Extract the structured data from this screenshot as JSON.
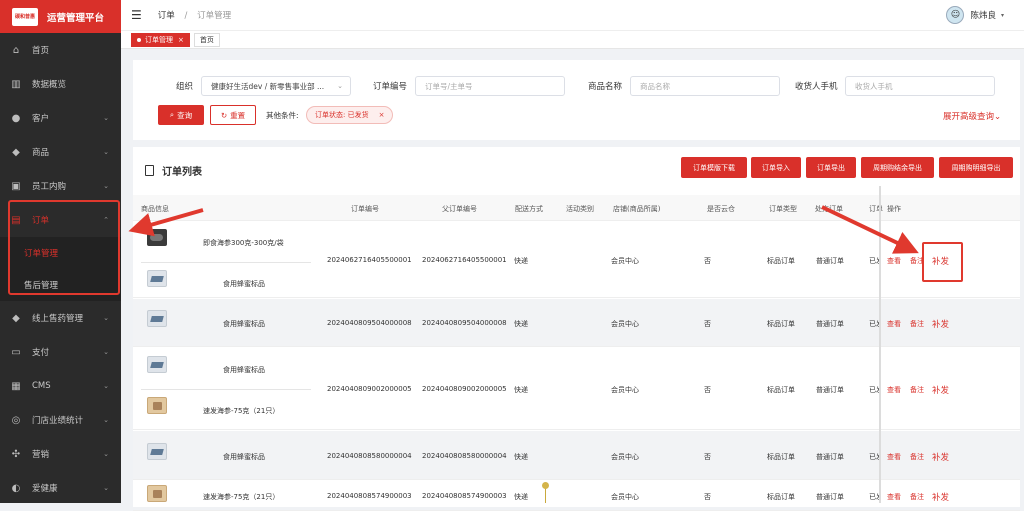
{
  "app": {
    "title": "运营管理平台",
    "logo_text": "碳和普惠"
  },
  "sidebar": {
    "items": [
      {
        "label": "首页",
        "icon": "home-icon",
        "glyph": "⌂"
      },
      {
        "label": "数据概览",
        "icon": "dashboard-icon",
        "glyph": "▥"
      },
      {
        "label": "客户",
        "icon": "user-icon",
        "glyph": "●",
        "chevron": "⌄"
      },
      {
        "label": "商品",
        "icon": "diamond-icon",
        "glyph": "◆",
        "chevron": "⌄"
      },
      {
        "label": "员工内购",
        "icon": "bag-icon",
        "glyph": "▣",
        "chevron": "⌄"
      },
      {
        "label": "订单",
        "icon": "order-icon",
        "glyph": "▤",
        "chevron": "⌃"
      },
      {
        "label": "线上售药管理",
        "icon": "diamond-icon",
        "glyph": "◆",
        "chevron": "⌄"
      },
      {
        "label": "支付",
        "icon": "wallet-icon",
        "glyph": "▭",
        "chevron": "⌄"
      },
      {
        "label": "CMS",
        "icon": "grid-icon",
        "glyph": "▦",
        "chevron": "⌄"
      },
      {
        "label": "门店业绩统计",
        "icon": "person-icon",
        "glyph": "◎",
        "chevron": "⌄"
      },
      {
        "label": "营销",
        "icon": "network-icon",
        "glyph": "✣",
        "chevron": "⌄"
      },
      {
        "label": "爱健康",
        "icon": "heart-icon",
        "glyph": "◐",
        "chevron": "⌄"
      }
    ],
    "sub_items": [
      {
        "label": "订单管理"
      },
      {
        "label": "售后管理"
      }
    ]
  },
  "topbar": {
    "menu_glyph": "☰",
    "breadcrumb": [
      "订单",
      "订单管理"
    ],
    "breadcrumb_sep": "/",
    "user_name": "陈炜良",
    "user_glyph": "☺",
    "dropdown_glyph": "▾"
  },
  "tabs": [
    {
      "label": "订单管理",
      "close": "×",
      "active": true
    },
    {
      "label": "首页",
      "active": false
    }
  ],
  "filters": {
    "org_label": "组织",
    "org_value": "健康好生活dev / 新零售事业部 ...",
    "order_no_label": "订单编号",
    "order_no_placeholder": "订单号/主单号",
    "product_label": "商品名称",
    "product_placeholder": "商品名称",
    "phone_label": "收货人手机",
    "phone_placeholder": "收货人手机",
    "query_button": "查询",
    "query_glyph": "⌕",
    "reset_button": "重置",
    "reset_glyph": "↻",
    "other_label": "其他条件:",
    "chip_label": "订单状态: 已发货",
    "chip_close": "×",
    "advanced_label": "展开高级查询",
    "chevron": "⌄"
  },
  "list": {
    "title": "订单列表",
    "actions": [
      "订单模版下载",
      "订单导入",
      "订单导出",
      "周期购结余导出",
      "周期购明细导出"
    ],
    "columns": [
      "商品信息",
      "订单编号",
      "父订单编号",
      "配送方式",
      "活动类别",
      "店铺(商品所属)",
      "是否云仓",
      "订单类型",
      "处方订单",
      "订单",
      "操作"
    ],
    "rows": [
      {
        "products": [
          {
            "name": "即食海参300克-300克/袋",
            "image": "sea-cucumber"
          },
          {
            "name": "食用蜂蜜标品",
            "image": "honey-box"
          }
        ],
        "order_no": "2024062716405500001",
        "parent_no": "2024062716405500001",
        "delivery": "快递",
        "activity": "",
        "shop": "会员中心",
        "cloud": "否",
        "type": "标品订单",
        "rx": "普通订单",
        "status": "已发",
        "ops": [
          "查看",
          "备注",
          "补发"
        ]
      },
      {
        "products": [
          {
            "name": "食用蜂蜜标品",
            "image": "honey-box"
          }
        ],
        "order_no": "2024040809504000008",
        "parent_no": "2024040809504000008",
        "delivery": "快递",
        "activity": "",
        "shop": "会员中心",
        "cloud": "否",
        "type": "标品订单",
        "rx": "普通订单",
        "status": "已发",
        "ops": [
          "查看",
          "备注",
          "补发"
        ]
      },
      {
        "products": [
          {
            "name": "食用蜂蜜标品",
            "image": "honey-box"
          },
          {
            "name": "速发海参-75克（21只）",
            "image": "sea-bag"
          }
        ],
        "order_no": "2024040809002000005",
        "parent_no": "2024040809002000005",
        "delivery": "快递",
        "activity": "",
        "shop": "会员中心",
        "cloud": "否",
        "type": "标品订单",
        "rx": "普通订单",
        "status": "已发",
        "ops": [
          "查看",
          "备注",
          "补发"
        ]
      },
      {
        "products": [
          {
            "name": "食用蜂蜜标品",
            "image": "honey-box"
          }
        ],
        "order_no": "2024040808580000004",
        "parent_no": "2024040808580000004",
        "delivery": "快递",
        "activity": "",
        "shop": "会员中心",
        "cloud": "否",
        "type": "标品订单",
        "rx": "普通订单",
        "status": "已发",
        "ops": [
          "查看",
          "备注",
          "补发"
        ]
      },
      {
        "products": [
          {
            "name": "速发海参-75克（21只）",
            "image": "sea-bag"
          }
        ],
        "order_no": "2024040808574900003",
        "parent_no": "2024040808574900003",
        "delivery": "快递",
        "activity": "",
        "shop": "会员中心",
        "cloud": "否",
        "type": "标品订单",
        "rx": "普通订单",
        "status": "已发",
        "ops": [
          "查看",
          "备注",
          "补发"
        ]
      }
    ]
  },
  "colors": {
    "accent": "#d9302a",
    "sidebar": "#2b2b2b",
    "annotation": "#e0392e"
  }
}
